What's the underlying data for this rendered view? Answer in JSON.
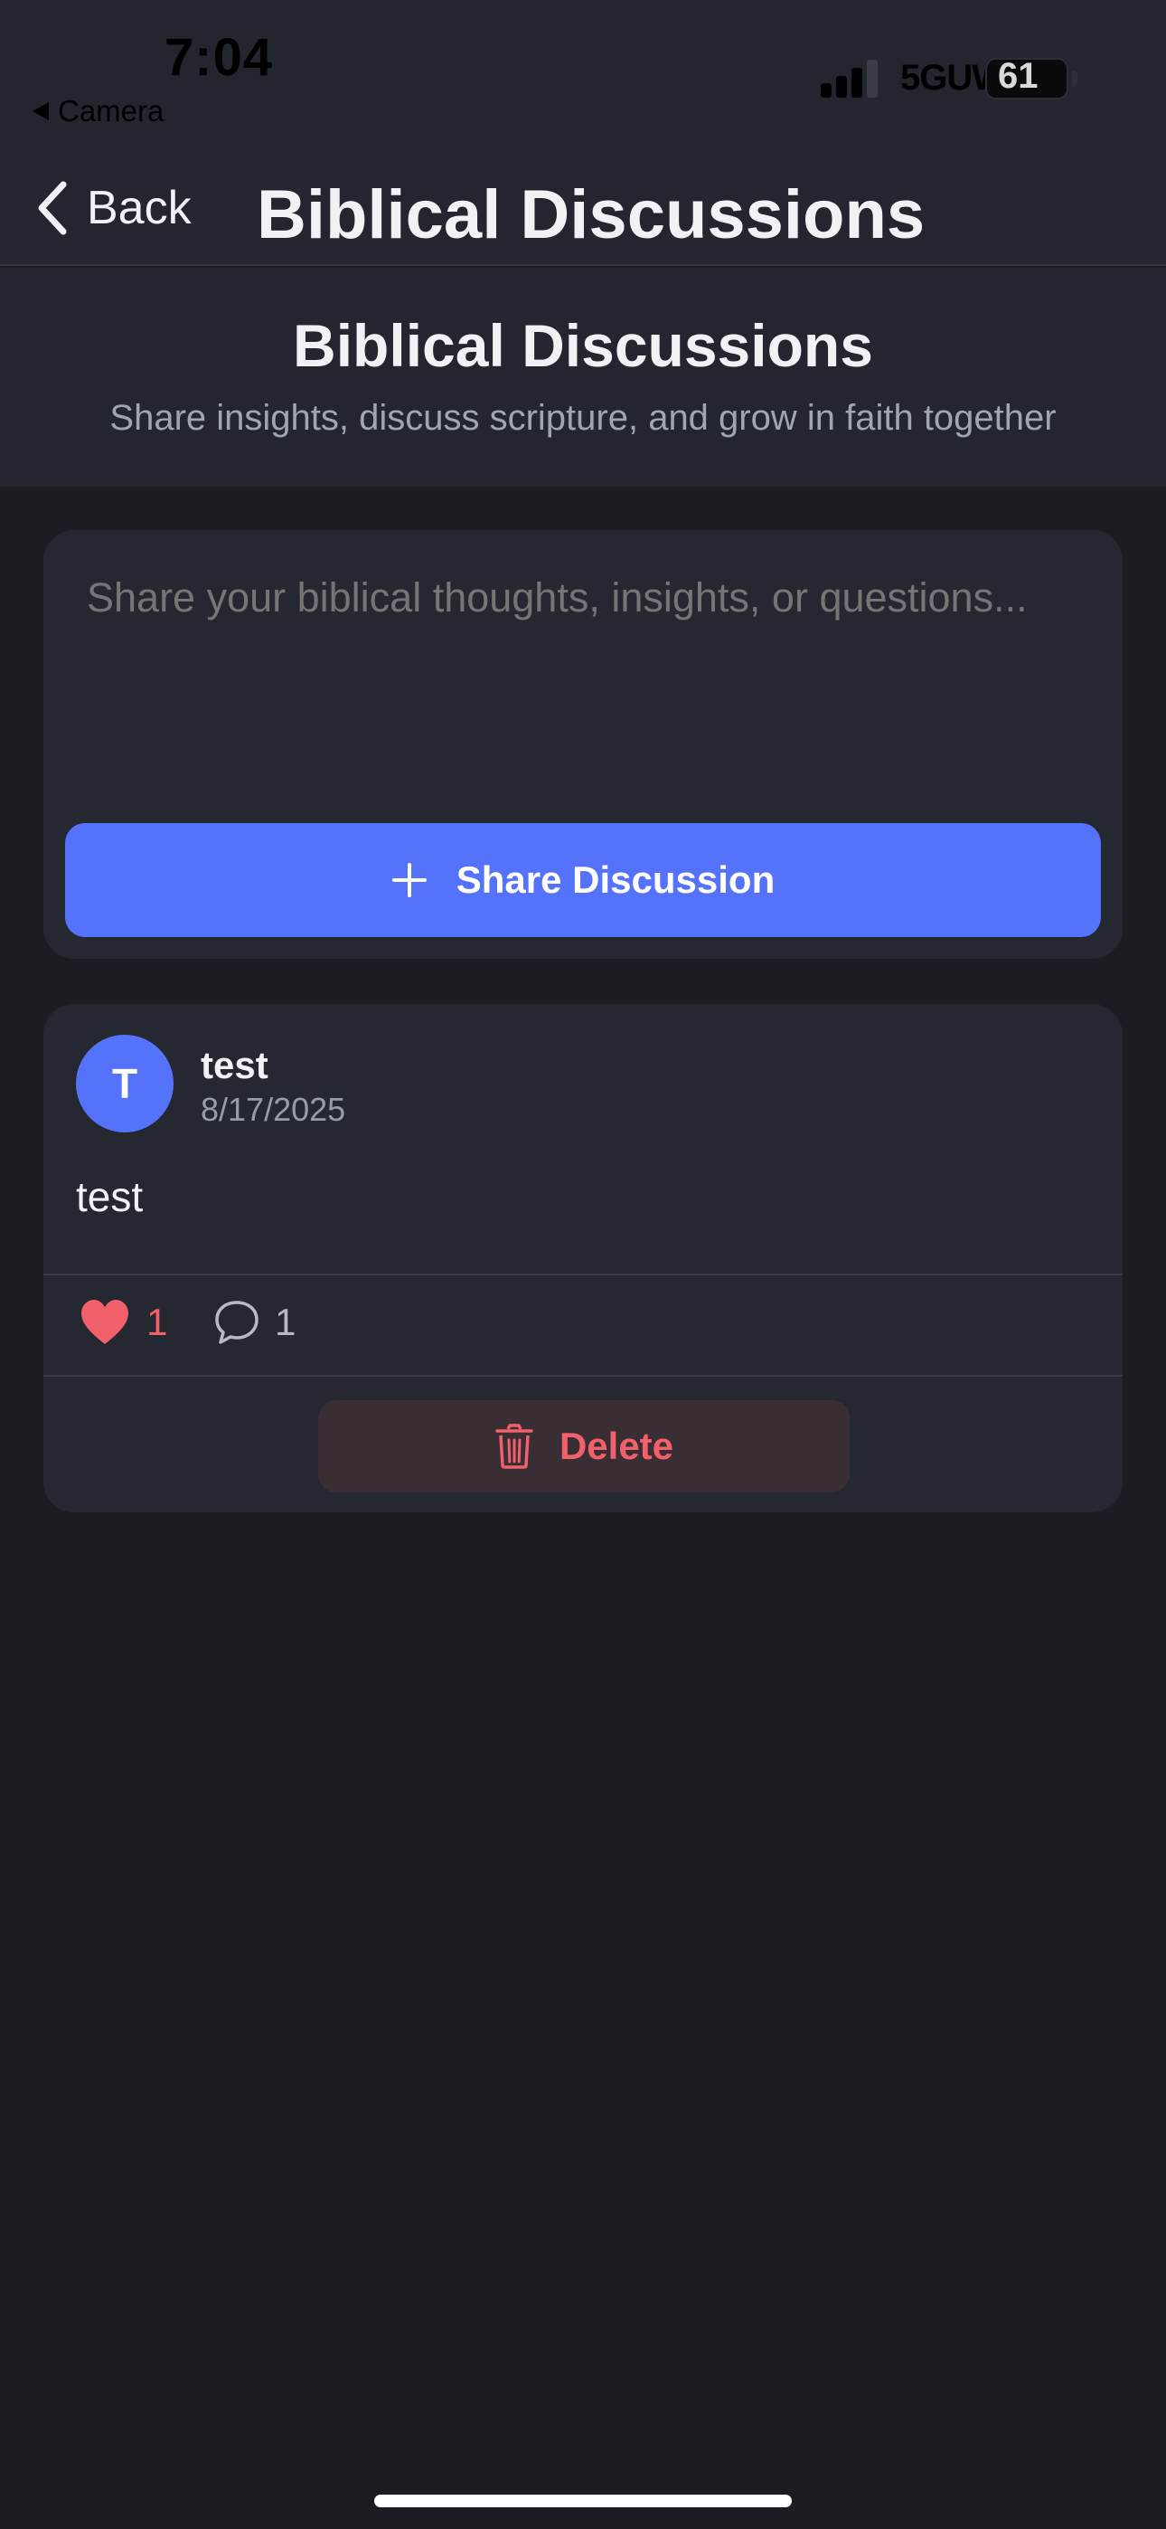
{
  "status_bar": {
    "time": "7:04",
    "back_app": "Camera",
    "network": "5GUW",
    "battery": "61",
    "signal_icon": "cellular-signal-icon",
    "battery_icon": "battery-icon"
  },
  "nav": {
    "back_label": "Back",
    "back_icon": "chevron-left-icon",
    "title": "Biblical Discussions"
  },
  "header": {
    "title": "Biblical Discussions",
    "subtitle": "Share insights, discuss scripture, and grow in faith together"
  },
  "composer": {
    "placeholder": "Share your biblical thoughts, insights, or questions...",
    "value": "",
    "share_label": "Share Discussion",
    "share_icon": "plus-icon"
  },
  "posts": [
    {
      "avatar_initial": "T",
      "author": "test",
      "date": "8/17/2025",
      "body": "test",
      "likes": "1",
      "like_icon": "heart-icon",
      "comments": "1",
      "comment_icon": "comment-icon",
      "delete_label": "Delete",
      "delete_icon": "trash-icon"
    }
  ],
  "colors": {
    "background": "#1b1d22",
    "surface": "#252831",
    "header": "#23262f",
    "accent": "#5572fb",
    "danger": "#f2606c"
  }
}
